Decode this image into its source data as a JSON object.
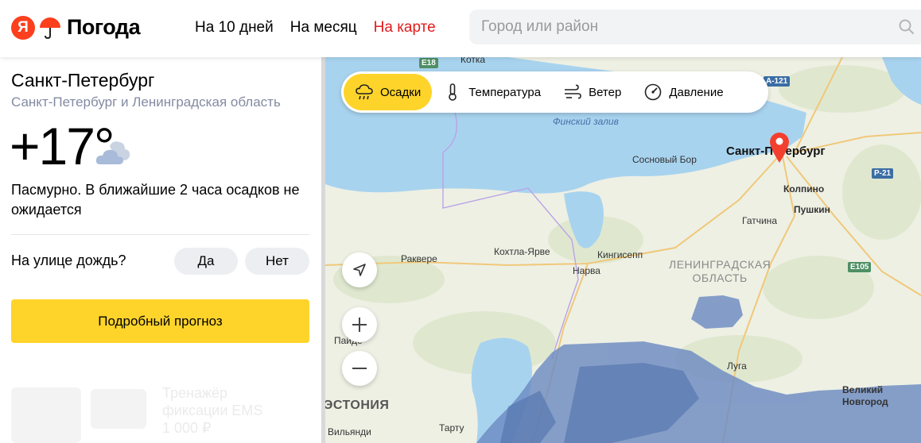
{
  "header": {
    "logo_mark": "Я",
    "logo_text": "Погода",
    "nav": [
      {
        "label": "На 10 дней",
        "active": false
      },
      {
        "label": "На месяц",
        "active": false
      },
      {
        "label": "На карте",
        "active": true
      }
    ],
    "search": {
      "placeholder": "Город или район",
      "value": ""
    }
  },
  "weather": {
    "city": "Санкт-Петербург",
    "region": "Санкт-Петербург и Ленинградская область",
    "temperature": "+17°",
    "icon": "cloud-icon",
    "condition": "Пасмурно. В ближайшие 2 часа осадков не ожидается",
    "rain_question": "На улице дождь?",
    "yes_label": "Да",
    "no_label": "Нет",
    "forecast_button": "Подробный прогноз"
  },
  "ad": {
    "text": "Тренажёр\nфиксации EMS\n1 000 ₽"
  },
  "map": {
    "layers": [
      {
        "label": "Осадки",
        "icon": "rain-cloud-icon",
        "active": true
      },
      {
        "label": "Температура",
        "icon": "thermometer-icon",
        "active": false
      },
      {
        "label": "Ветер",
        "icon": "wind-icon",
        "active": false
      },
      {
        "label": "Давление",
        "icon": "gauge-icon",
        "active": false
      }
    ],
    "labels": {
      "gulf": "Финский залив",
      "spb": "Санкт-Петербург",
      "sosnovy_bor": "Сосновый Бор",
      "kolpino": "Колпино",
      "pushkin": "Пушкин",
      "gatchina": "Гатчина",
      "kingisepp": "Кингисепп",
      "narva": "Нарва",
      "kohtla": "Кохтла-Ярве",
      "rakvere": "Раквере",
      "kotka": "Котка",
      "region": "ЛЕНИНГРАДСКАЯ\nОБЛАСТЬ",
      "estonia": "ЭСТОНИЯ",
      "luga": "Луга",
      "veliky": "Великий\nНовгород",
      "paide": "Пайде",
      "tartu": "Тарту",
      "viljandi": "Вильянди"
    },
    "shields": {
      "e18": "E18",
      "a121": "А-121",
      "r21": "Р-21",
      "e105": "E105"
    },
    "accent_precip": "#6d8bc2"
  },
  "colors": {
    "accent": "#fed42b",
    "nav_active": "#e21b1b",
    "water": "#a8d3ef",
    "land": "#eef0e4"
  }
}
